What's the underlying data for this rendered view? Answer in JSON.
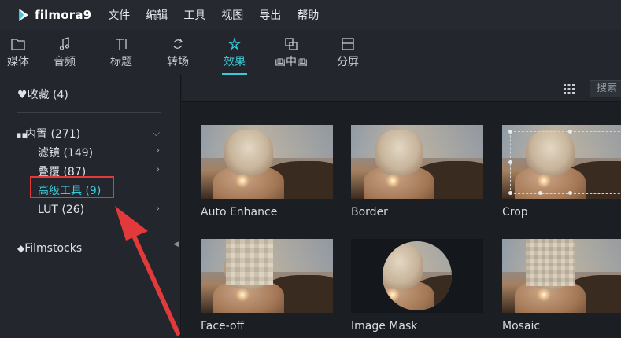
{
  "app": {
    "name": "filmora9"
  },
  "menu": [
    "文件",
    "编辑",
    "工具",
    "视图",
    "导出",
    "帮助"
  ],
  "toolbar": [
    {
      "label": "媒体",
      "icon": "folder-icon"
    },
    {
      "label": "音频",
      "icon": "music-note-icon"
    },
    {
      "label": "标题",
      "icon": "text-icon"
    },
    {
      "label": "转场",
      "icon": "transition-icon"
    },
    {
      "label": "效果",
      "icon": "effects-icon",
      "active": true
    },
    {
      "label": "画中画",
      "icon": "picture-in-picture-icon"
    },
    {
      "label": "分屏",
      "icon": "split-screen-icon"
    }
  ],
  "sidebar": {
    "favorites": "收藏 (4)",
    "builtin": "内置 (271)",
    "sub": [
      "滤镜 (149)",
      "叠覆 (87)",
      "高级工具 (9)",
      "LUT (26)"
    ],
    "filmstocks": "Filmstocks"
  },
  "search": {
    "placeholder": "搜索"
  },
  "effects": [
    "Auto Enhance",
    "Border",
    "Crop",
    "Face-off",
    "Image Mask",
    "Mosaic"
  ],
  "colors": {
    "accent": "#3ec9d6",
    "highlight": "#e23a3a"
  }
}
